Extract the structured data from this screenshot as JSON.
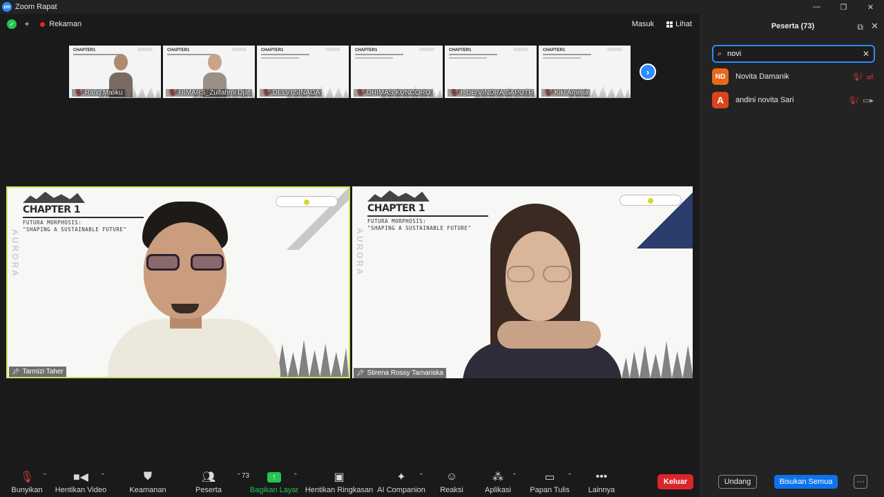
{
  "window": {
    "title": "Zoom Rapat",
    "logo_text": "zm",
    "controls": [
      "—",
      "❐",
      "✕"
    ]
  },
  "topbar": {
    "recording_label": "Rekaman",
    "masuk_label": "Masuk",
    "lihat_label": "Lihat"
  },
  "thumbnails": [
    {
      "name": "Rafiq Maliku",
      "has_person": true
    },
    {
      "name": "HIMARS_Zulfahmi Djaf...",
      "has_person": true
    },
    {
      "name": "DELVI SINAGA",
      "has_person": false
    },
    {
      "name": "DHIMAS KUNCORO",
      "has_person": false
    },
    {
      "name": "I_DE VINDRA SAPUTR...",
      "has_person": false
    },
    {
      "name": "Kiki Amelia",
      "has_person": false
    }
  ],
  "slide": {
    "chapter": "CHAPTER 1",
    "line1": "FUTURA MORPHOSIS:",
    "line2": "\"SHAPING A SUSTAINABLE FUTURE\"",
    "thumb_head": "CHAPTER1",
    "side_text": "AURORA"
  },
  "main_tiles": [
    {
      "name": "Tarmizi Taher",
      "active_speaker": true
    },
    {
      "name": "Stirena Rossy Tamariska",
      "active_speaker": false
    }
  ],
  "toolbar": {
    "mute": "Bunyikan",
    "video": "Hentikan Video",
    "security": "Keamanan",
    "participants": "Peserta",
    "participants_count": "73",
    "share": "Bagikan Layar",
    "summary": "Hentikan Ringkasan",
    "ai": "AI Companion",
    "reactions": "Reaksi",
    "apps": "Aplikasi",
    "whiteboard": "Papan Tulis",
    "more": "Lainnya",
    "leave": "Keluar"
  },
  "panel": {
    "title": "Peserta (73)",
    "search_value": "novi",
    "participants": [
      {
        "initials": "ND",
        "name": "Novita Damanik",
        "color": "#e8681a"
      },
      {
        "initials": "A",
        "name": "andini novita Sari",
        "color": "#d9431e"
      }
    ],
    "invite": "Undang",
    "mute_all": "Bisukan Semua",
    "more": "···"
  },
  "colors": {
    "accent": "#2d8cff",
    "share_green": "#23c552",
    "leave_red": "#d9262c",
    "active_border": "#c8e65c"
  }
}
